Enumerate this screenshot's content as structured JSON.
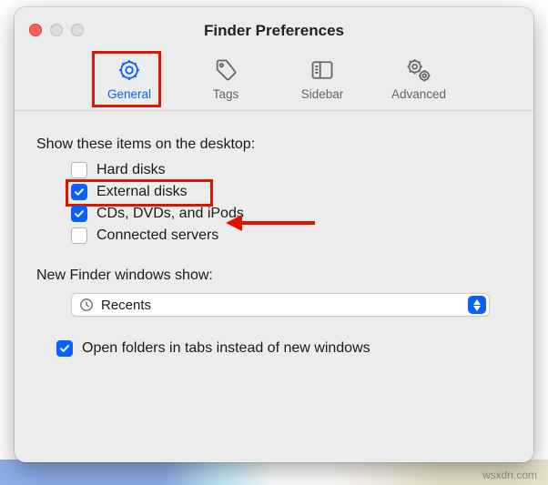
{
  "annotations": {
    "highlight_color": "#e11400"
  },
  "window": {
    "title": "Finder Preferences"
  },
  "tabs": [
    {
      "id": "general",
      "label": "General",
      "icon": "gear",
      "active": true
    },
    {
      "id": "tags",
      "label": "Tags",
      "icon": "tag",
      "active": false
    },
    {
      "id": "sidebar",
      "label": "Sidebar",
      "icon": "sidebar",
      "active": false
    },
    {
      "id": "advanced",
      "label": "Advanced",
      "icon": "gears",
      "active": false
    }
  ],
  "desktop_section": {
    "label": "Show these items on the desktop:",
    "items": [
      {
        "id": "hard-disks",
        "label": "Hard disks",
        "checked": false
      },
      {
        "id": "external-disks",
        "label": "External disks",
        "checked": true,
        "highlighted": true
      },
      {
        "id": "cds-dvds-ipods",
        "label": "CDs, DVDs, and iPods",
        "checked": true
      },
      {
        "id": "connected-servers",
        "label": "Connected servers",
        "checked": false
      }
    ]
  },
  "new_windows": {
    "label": "New Finder windows show:",
    "value": "Recents",
    "icon": "clock"
  },
  "tabs_checkbox": {
    "label": "Open folders in tabs instead of new windows",
    "checked": true
  },
  "watermark": "wsxdn.com"
}
